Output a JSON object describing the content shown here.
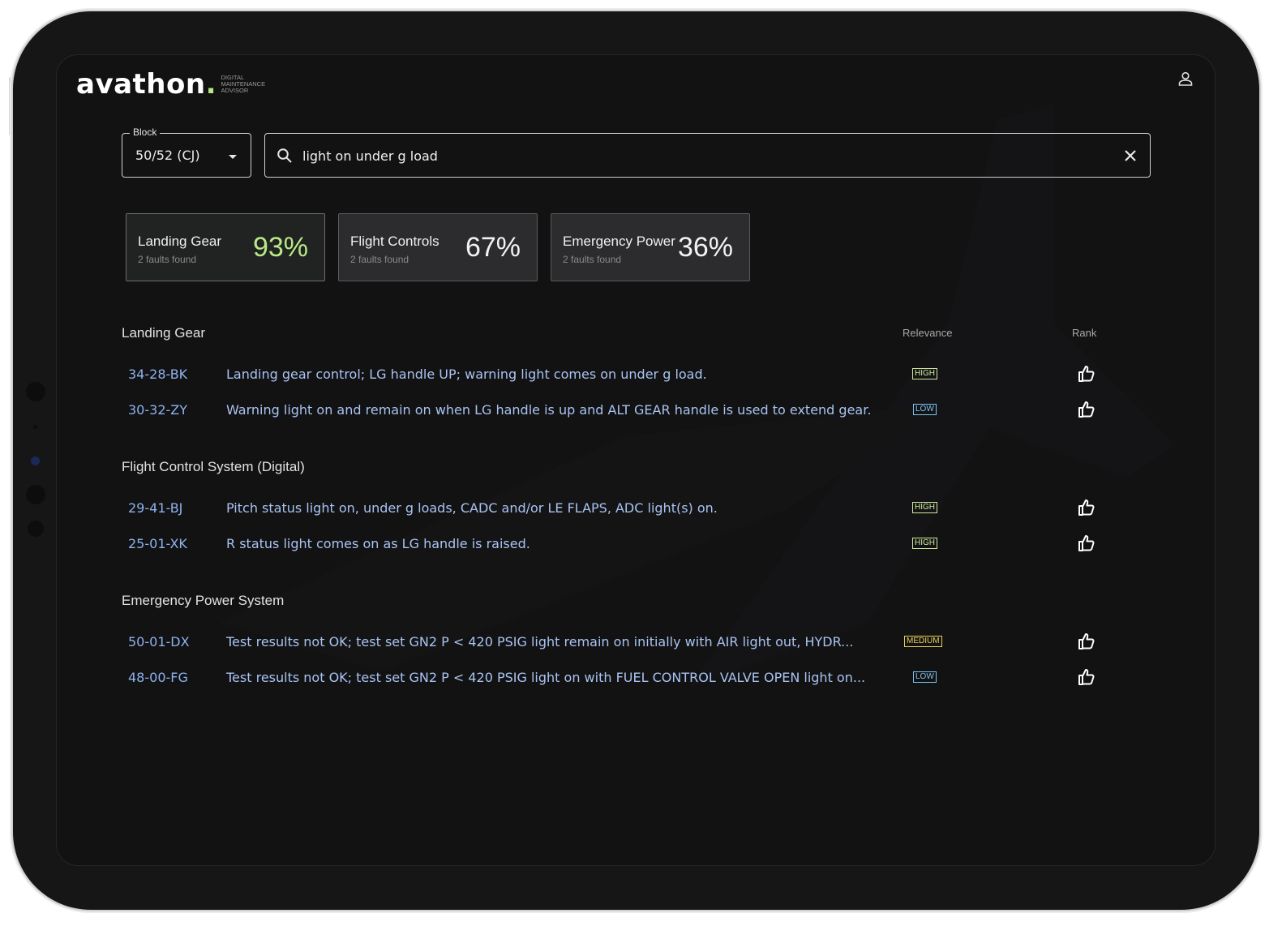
{
  "header": {
    "logo_text": "avathon",
    "logo_dot": ".",
    "logo_tagline": [
      "DIGITAL",
      "MAINTENANCE",
      "ADVISOR"
    ],
    "user_icon": "user-icon"
  },
  "controls": {
    "block": {
      "label": "Block",
      "value": "50/52 (CJ)"
    },
    "search": {
      "value": "light on under g load",
      "search_icon": "search-icon",
      "clear_icon": "close-icon"
    }
  },
  "cards": [
    {
      "title": "Landing Gear",
      "subtitle": "2 faults found",
      "percent": "93%",
      "active": true
    },
    {
      "title": "Flight Controls",
      "subtitle": "2 faults found",
      "percent": "67%",
      "active": false
    },
    {
      "title": "Emergency Power",
      "subtitle": "2 faults found",
      "percent": "36%",
      "active": false
    }
  ],
  "columns": {
    "relevance": "Relevance",
    "rank": "Rank"
  },
  "sections": [
    {
      "title": "Landing Gear",
      "rows": [
        {
          "code": "34-28-BK",
          "description": "Landing gear control; LG handle UP; warning light comes on under g load.",
          "relevance": "HIGH"
        },
        {
          "code": "30-32-ZY",
          "description": "Warning light on and remain on when LG handle is up and ALT GEAR handle is used to extend gear.",
          "relevance": "LOW"
        }
      ]
    },
    {
      "title": "Flight Control System (Digital)",
      "rows": [
        {
          "code": "29-41-BJ",
          "description": "Pitch status light on, under g loads, CADC and/or LE FLAPS, ADC light(s) on.",
          "relevance": "HIGH"
        },
        {
          "code": "25-01-XK",
          "description": "R status light comes on as LG handle is raised.",
          "relevance": "HIGH"
        }
      ]
    },
    {
      "title": "Emergency Power System",
      "rows": [
        {
          "code": "50-01-DX",
          "description": "Test results not OK; test set GN2 P < 420 PSIG light remain on initially with AIR light out, HYDR...",
          "relevance": "MEDIUM"
        },
        {
          "code": "48-00-FG",
          "description": "Test results not OK; test set GN2 P < 420 PSIG light on with FUEL CONTROL VALVE OPEN light on...",
          "relevance": "LOW"
        }
      ]
    }
  ],
  "colors": {
    "accent": "#b8e986",
    "code_text": "#8eb2ee",
    "badge_high": "#cfe9a0",
    "badge_low": "#7ec3f0",
    "badge_medium": "#e9cf5a"
  }
}
